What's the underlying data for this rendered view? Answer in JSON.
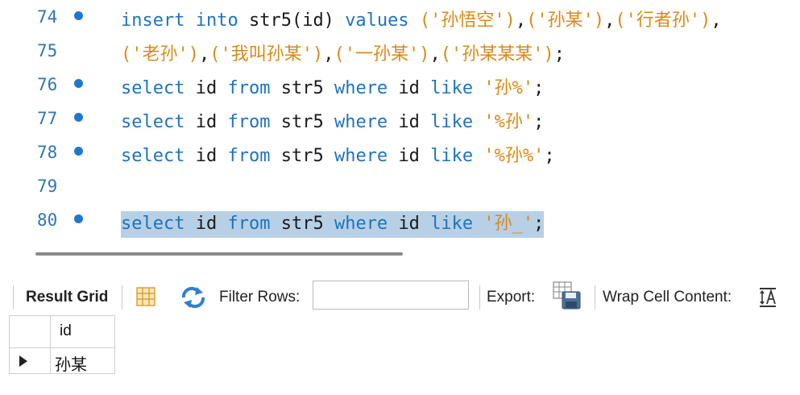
{
  "editor": {
    "lines": [
      {
        "number": "74",
        "has_dot": true
      },
      {
        "number": "75",
        "has_dot": false
      },
      {
        "number": "76",
        "has_dot": true
      },
      {
        "number": "77",
        "has_dot": true
      },
      {
        "number": "78",
        "has_dot": true
      },
      {
        "number": "79",
        "has_dot": false
      },
      {
        "number": "80",
        "has_dot": true
      }
    ],
    "code": {
      "l74": {
        "kw_insert": "insert",
        "kw_into": "into",
        "ident": "str5(id)",
        "kw_values": "values",
        "s1": "('孙悟空')",
        "c1": ",",
        "s2": "('孙某')",
        "c2": ",",
        "s3": "('行者孙')",
        "tail": ","
      },
      "l75": {
        "s1": "('老孙')",
        "c1": ",",
        "s2": "('我叫孙某')",
        "c2": ",",
        "s3": "('一孙某')",
        "c3": ",",
        "s4": "('孙某某某')",
        "tail": ";"
      },
      "l76": {
        "kw_select": "select",
        "col": "id",
        "kw_from": "from",
        "table": "str5",
        "kw_where": "where",
        "col2": "id",
        "kw_like": "like",
        "pattern": "'孙%'",
        "tail": ";"
      },
      "l77": {
        "kw_select": "select",
        "col": "id",
        "kw_from": "from",
        "table": "str5",
        "kw_where": "where",
        "col2": "id",
        "kw_like": "like",
        "pattern": "'%孙'",
        "tail": ";"
      },
      "l78": {
        "kw_select": "select",
        "col": "id",
        "kw_from": "from",
        "table": "str5",
        "kw_where": "where",
        "col2": "id",
        "kw_like": "like",
        "pattern": "'%孙%'",
        "tail": ";"
      },
      "l80": {
        "kw_select": "select",
        "col": "id",
        "kw_from": "from",
        "table": "str5",
        "kw_where": "where",
        "col2": "id",
        "kw_like": "like",
        "pattern": "'孙_'",
        "tail": ";"
      }
    }
  },
  "toolbar": {
    "result_grid_label": "Result Grid",
    "filter_rows_label": "Filter Rows:",
    "filter_value": "",
    "export_label": "Export:",
    "wrap_label": "Wrap Cell Content:",
    "icons": [
      "grid-form-icon",
      "refresh-icon",
      "export-save-icon",
      "wrap-text-icon"
    ]
  },
  "result": {
    "columns": [
      "id"
    ],
    "rows": [
      [
        "孙某"
      ]
    ]
  },
  "colors": {
    "keyword": "#1e73be",
    "string": "#d98a17",
    "line_number": "#2e76b8",
    "selection": "#b7d0e6"
  }
}
